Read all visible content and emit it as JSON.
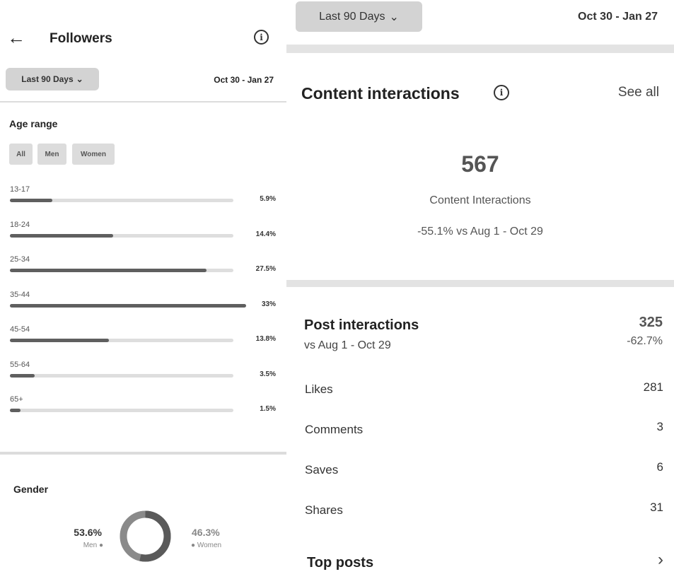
{
  "left": {
    "header": {
      "title": "Followers"
    },
    "filter": {
      "range_label": "Last 90 Days",
      "dates": "Oct 30 - Jan 27"
    },
    "age": {
      "heading": "Age range",
      "chips": [
        "All",
        "Men",
        "Women"
      ],
      "rows": [
        {
          "label": "13-17",
          "pct_label": "5.9%",
          "pct": 5.9
        },
        {
          "label": "18-24",
          "pct_label": "14.4%",
          "pct": 14.4
        },
        {
          "label": "25-34",
          "pct_label": "27.5%",
          "pct": 27.5
        },
        {
          "label": "35-44",
          "pct_label": "33%",
          "pct": 33
        },
        {
          "label": "45-54",
          "pct_label": "13.8%",
          "pct": 13.8
        },
        {
          "label": "55-64",
          "pct_label": "3.5%",
          "pct": 3.5
        },
        {
          "label": "65+",
          "pct_label": "1.5%",
          "pct": 1.5
        }
      ]
    },
    "gender": {
      "heading": "Gender",
      "men_pct_label": "53.6%",
      "men_label": "Men",
      "women_pct_label": "46.3%",
      "women_label": "Women",
      "men_share": 53.6
    }
  },
  "right": {
    "filter": {
      "range_label": "Last 90 Days",
      "dates": "Oct 30 - Jan 27"
    },
    "content": {
      "title": "Content interactions",
      "see_all": "See all",
      "total": "567",
      "total_label": "Content Interactions",
      "comparison": "-55.1% vs Aug 1 - Oct 29"
    },
    "post": {
      "title": "Post interactions",
      "subtitle": "vs Aug 1 - Oct 29",
      "value": "325",
      "change": "-62.7%",
      "rows": [
        {
          "label": "Likes",
          "value": "281"
        },
        {
          "label": "Comments",
          "value": "3"
        },
        {
          "label": "Saves",
          "value": "6"
        },
        {
          "label": "Shares",
          "value": "31"
        }
      ]
    },
    "top_posts": {
      "label": "Top posts"
    }
  },
  "colors": {
    "bar_fill": "#5f5f5f",
    "bar_track": "#dedede",
    "pill_bg": "#d3d3d3"
  }
}
